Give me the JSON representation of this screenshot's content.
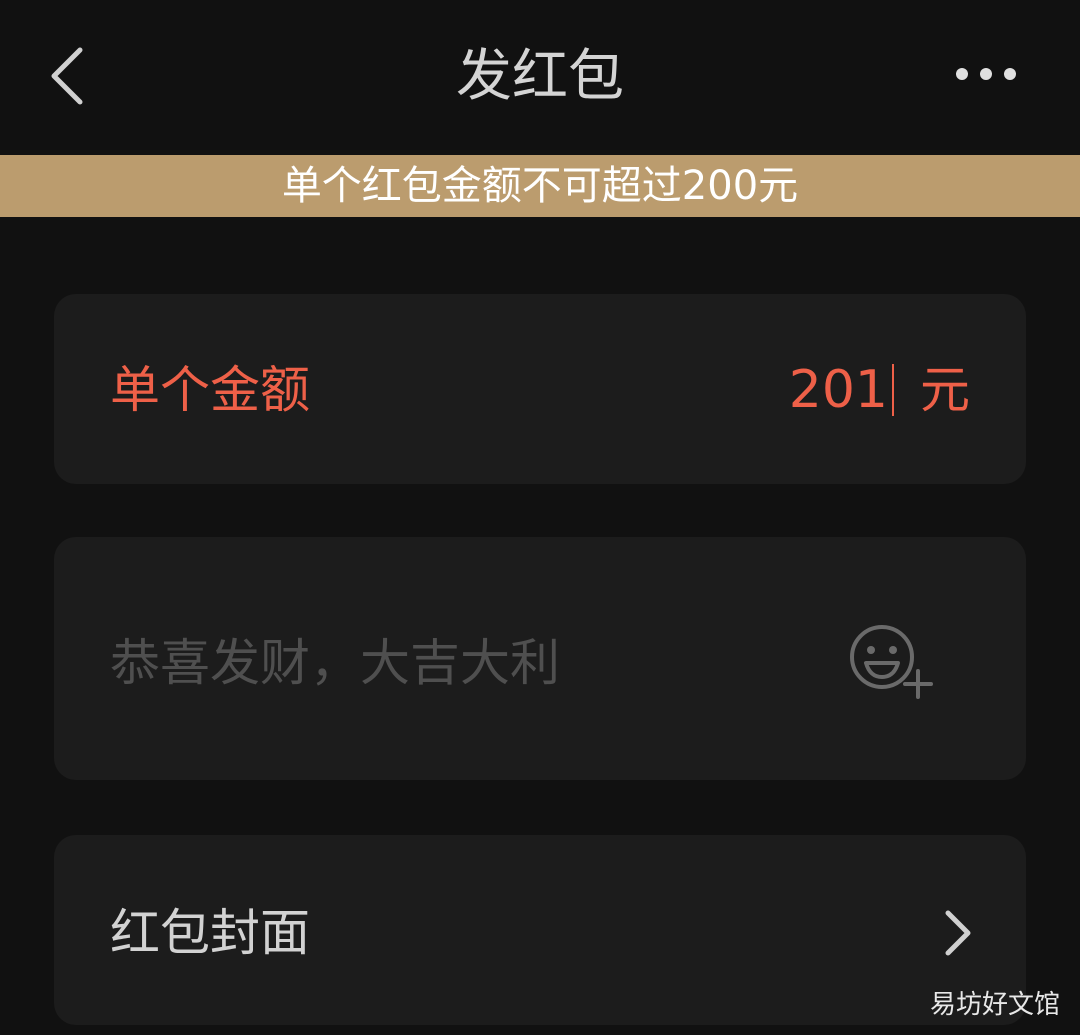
{
  "header": {
    "title": "发红包",
    "back_icon": "chevron-left-icon",
    "more_icon": "more-horizontal-icon"
  },
  "notice": {
    "text": "单个红包金额不可超过200元",
    "color": "#bb9c6e"
  },
  "amount": {
    "label": "单个金额",
    "value": "201",
    "unit": "元",
    "color": "#ee6048"
  },
  "message": {
    "placeholder": "恭喜发财，大吉大利",
    "emoji_icon": "emoji-add-icon"
  },
  "cover": {
    "label": "红包封面",
    "chevron_icon": "chevron-right-icon"
  },
  "watermark": {
    "text": "易坊好文馆"
  }
}
